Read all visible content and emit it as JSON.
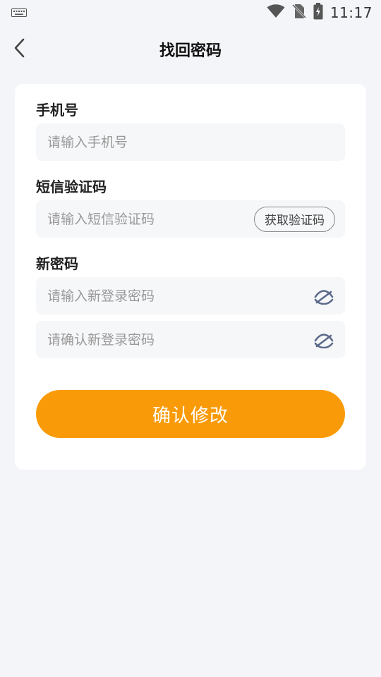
{
  "status_bar": {
    "time": "11:17",
    "icons": [
      "keyboard-icon",
      "wifi-icon",
      "no-sim-icon",
      "battery-charging-icon"
    ]
  },
  "header": {
    "title": "找回密码",
    "back_icon": "chevron-left-icon"
  },
  "form": {
    "phone": {
      "label": "手机号",
      "placeholder": "请输入手机号",
      "value": ""
    },
    "sms": {
      "label": "短信验证码",
      "placeholder": "请输入短信验证码",
      "value": "",
      "get_code_label": "获取验证码"
    },
    "new_password": {
      "label": "新密码",
      "placeholder": "请输入新登录密码",
      "value": "",
      "toggle_icon": "eye-hidden-icon"
    },
    "confirm_password": {
      "placeholder": "请确认新登录密码",
      "value": "",
      "toggle_icon": "eye-hidden-icon"
    },
    "submit_label": "确认修改"
  },
  "colors": {
    "accent": "#f99b08",
    "background": "#f4f5f9",
    "card": "#ffffff",
    "field": "#f6f7f9",
    "toggle_icon": "#5b6a8a"
  }
}
